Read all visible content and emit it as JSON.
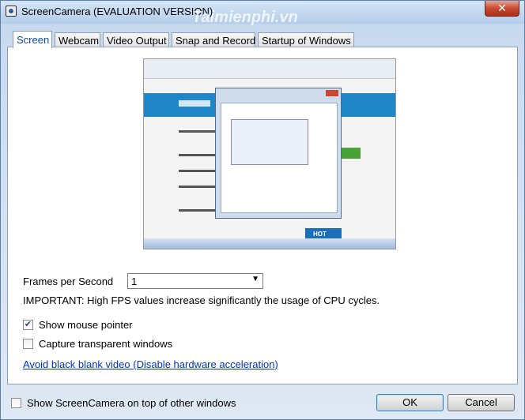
{
  "window": {
    "title": "ScreenCamera (EVALUATION VERSION)",
    "close_label": "✕",
    "watermark": "Taimienphi.vn"
  },
  "tabs": [
    {
      "label": "Screen",
      "active": true
    },
    {
      "label": "Webcam"
    },
    {
      "label": "Video Output"
    },
    {
      "label": "Snap and Record"
    },
    {
      "label": "Startup of Windows"
    }
  ],
  "preview": {
    "hot_label": "HOT"
  },
  "fps": {
    "label": "Frames per Second",
    "value": "1",
    "important": "IMPORTANT: High FPS values increase significantly the usage of CPU cycles."
  },
  "options": {
    "show_mouse_pointer": {
      "label": "Show mouse pointer",
      "checked": true
    },
    "capture_transparent": {
      "label": "Capture transparent windows",
      "checked": false
    }
  },
  "link": "Avoid black blank video (Disable hardware acceleration)",
  "footer": {
    "on_top_label": "Show ScreenCamera on top of other windows",
    "ok_label": "OK",
    "cancel_label": "Cancel"
  },
  "icons": {
    "app": "camera-icon",
    "checkmark": "✔",
    "dropdown": "▼"
  }
}
